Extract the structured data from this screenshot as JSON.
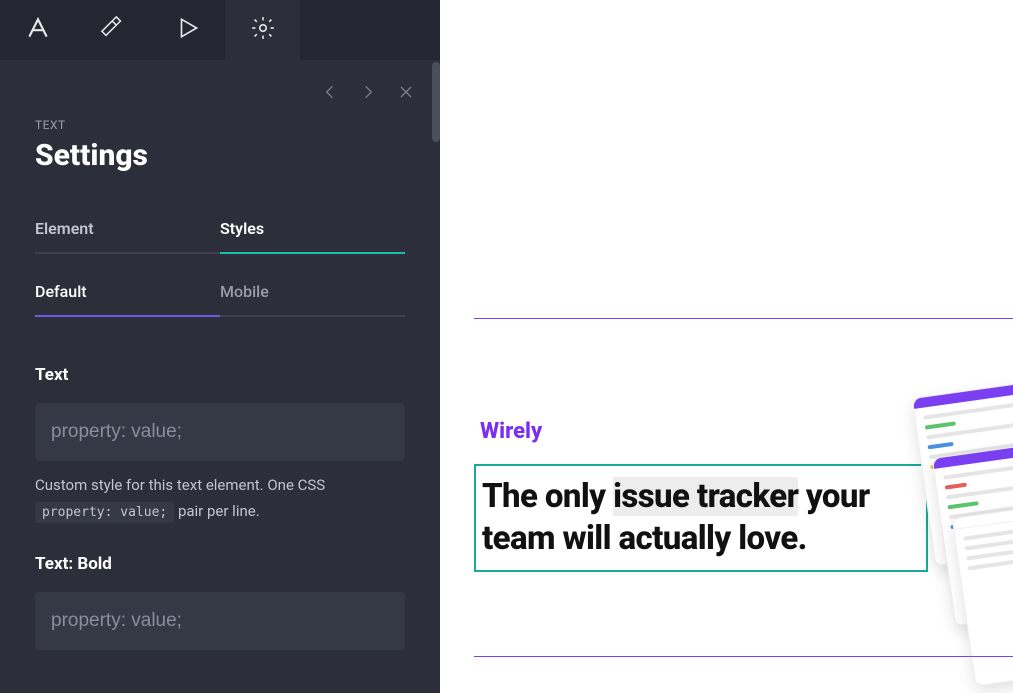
{
  "panel": {
    "eyebrow": "TEXT",
    "title": "Settings",
    "mainTabs": {
      "element": "Element",
      "styles": "Styles"
    },
    "subTabs": {
      "default": "Default",
      "mobile": "Mobile"
    },
    "fields": {
      "text": {
        "label": "Text",
        "placeholder": "property: value;"
      },
      "helpPre": "Custom style for this text element. One CSS ",
      "helpCode": "property: value;",
      "helpPost": " pair per line.",
      "textBold": {
        "label": "Text: Bold",
        "placeholder": "property: value;"
      }
    }
  },
  "preview": {
    "brand": "Wirely",
    "headlinePre": "The only ",
    "headlineHighlight": "issue tracker",
    "headlinePost": " your team will actually love."
  }
}
